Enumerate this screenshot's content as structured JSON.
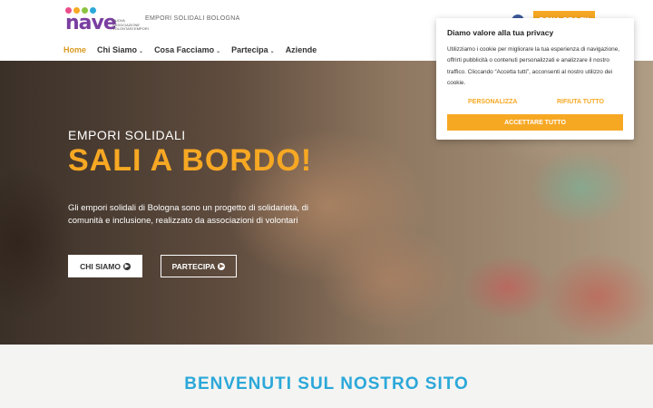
{
  "header": {
    "logo_text": "nave",
    "logo_subtext": "NUOVA ASSOCIAZIONE VOLONTARI EMPORI",
    "tagline": "EMPORI SOLIDALI BOLOGNA",
    "facebook_icon": "facebook-icon",
    "donate_label": "DONA ORA 5X",
    "logo_colors": [
      "#e94f8a",
      "#f7a823",
      "#8bc53f",
      "#2ba8d9"
    ]
  },
  "nav": {
    "items": [
      {
        "label": "Home",
        "active": true
      },
      {
        "label": "Chi Siamo",
        "dropdown": true
      },
      {
        "label": "Cosa Facciamo",
        "dropdown": true
      },
      {
        "label": "Partecipa",
        "dropdown": true
      },
      {
        "label": "Aziende"
      }
    ]
  },
  "hero": {
    "eyebrow": "EMPORI SOLIDALI",
    "title": "SALI A BORDO!",
    "description": "Gli empori solidali di Bologna sono un progetto di solidarietà, di comunità e inclusione, realizzato da associazioni di volontari",
    "button_primary": "CHI SIAMO",
    "button_secondary": "PARTECIPA"
  },
  "welcome": {
    "title": "BENVENUTI SUL NOSTRO SITO"
  },
  "cookie": {
    "title": "Diamo valore alla tua privacy",
    "text": "Utilizziamo i cookie per migliorare la tua esperienza di navigazione, offrirti pubblicità o contenuti personalizzati e analizzare il nostro traffico. Cliccando “Accetta tutti”, acconsenti al nostro utilizzo dei cookie.",
    "customize_label": "PERSONALIZZA",
    "reject_label": "RIFIUTA TUTTO",
    "accept_label": "ACCETTARE TUTTO"
  },
  "colors": {
    "accent": "#f7a823",
    "title_blue": "#2ba8d9",
    "logo_purple": "#7a3ea0"
  }
}
